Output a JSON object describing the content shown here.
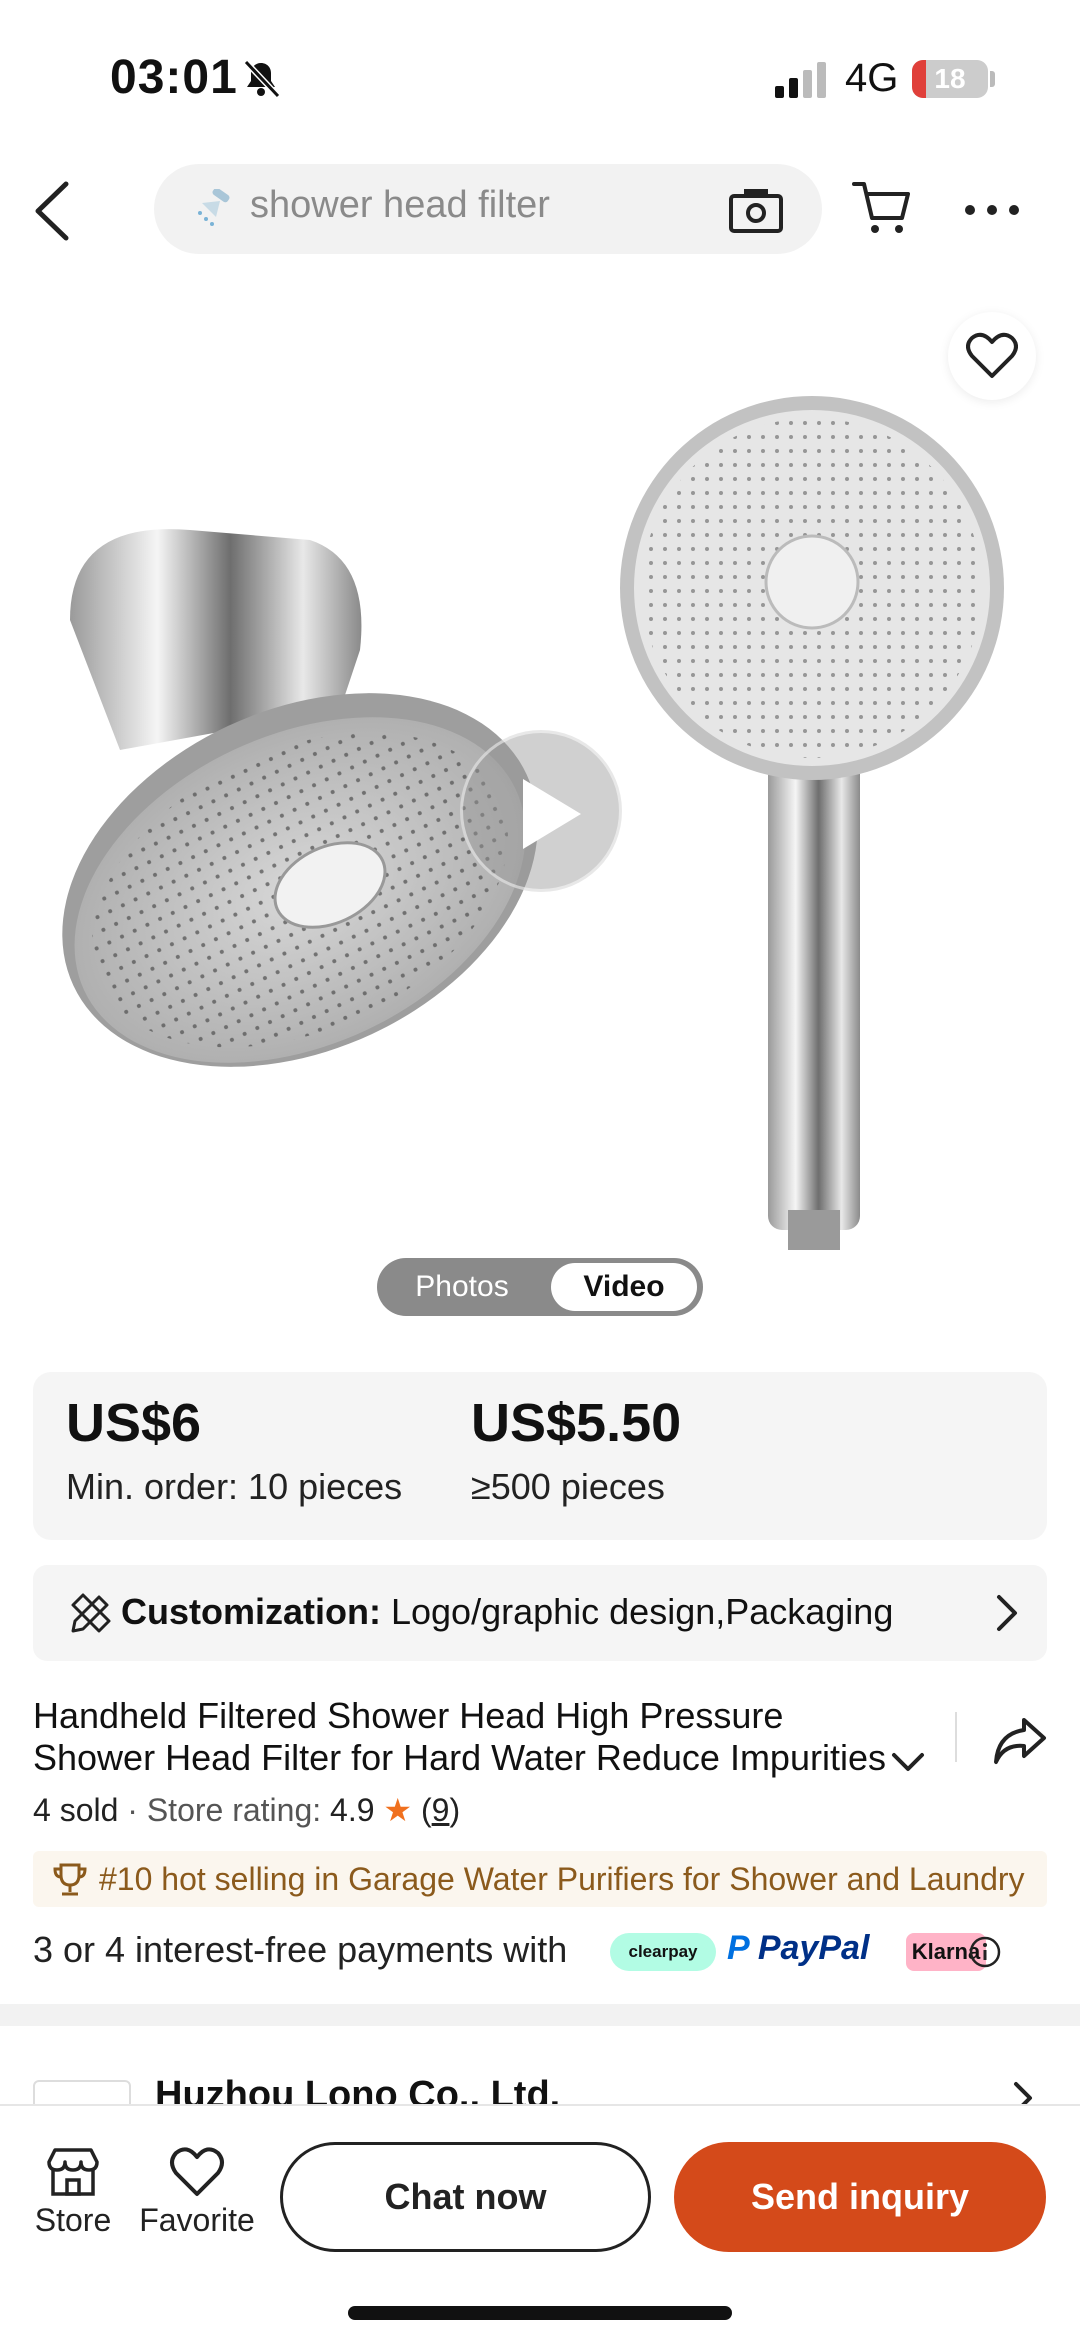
{
  "status_bar": {
    "time": "03:01",
    "network": "4G",
    "battery_level": "18",
    "battery_fraction": 0.18,
    "icons": [
      "bell-muted-icon",
      "signal-icon",
      "battery-icon"
    ]
  },
  "header": {
    "search_text": "shower head filter",
    "icons": [
      "back-icon",
      "shower-icon",
      "camera-icon",
      "cart-icon",
      "more-icon"
    ]
  },
  "gallery": {
    "toggle": {
      "photos_label": "Photos",
      "video_label": "Video",
      "selected": "Video"
    },
    "icons": [
      "heart-icon",
      "play-icon"
    ]
  },
  "pricing": {
    "tiers": [
      {
        "price": "US$6",
        "qty": "Min. order: 10 pieces"
      },
      {
        "price": "US$5.50",
        "qty": "≥500 pieces"
      }
    ]
  },
  "customization": {
    "label": "Customization:",
    "value": " Logo/graphic design,Packaging"
  },
  "product": {
    "title": "Handheld Filtered Shower Head High Pressure Shower Head Filter for Hard Water Reduce Impurities",
    "sold": "4 sold",
    "separator": " · ",
    "store_rating_label": "Store rating: ",
    "store_rating_value": "4.9",
    "rating_count": "9"
  },
  "hot_selling": {
    "text": "#10 hot selling in Garage Water Purifiers for Shower and Laundry"
  },
  "payments": {
    "text": "3 or 4 interest-free payments with",
    "clearpay": "clearpay",
    "paypal": "PayPal",
    "klarna": "Klarna"
  },
  "supplier": {
    "name": "Huzhou Lono Co., Ltd."
  },
  "bottom_bar": {
    "store_label": "Store",
    "favorite_label": "Favorite",
    "chat_label": "Chat now",
    "inquiry_label": "Send inquiry"
  },
  "colors": {
    "accent": "#d44a1a",
    "star": "#f0701e",
    "hot_text": "#8b5a1c",
    "battery_low": "#e0403a"
  }
}
